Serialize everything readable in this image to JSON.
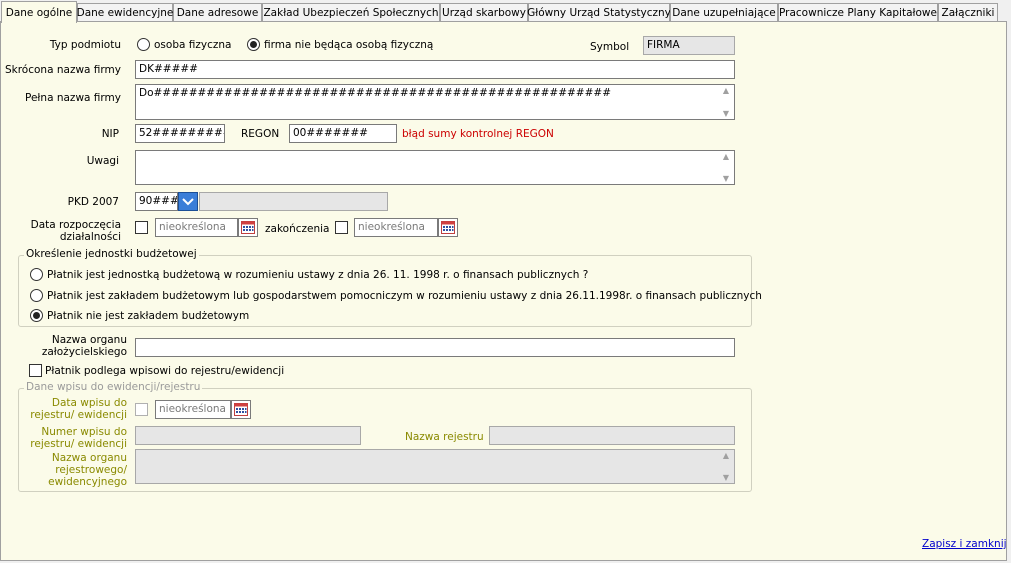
{
  "tabs": [
    {
      "label": "Dane ogólne",
      "active": true
    },
    {
      "label": "Dane ewidencyjne"
    },
    {
      "label": "Dane adresowe"
    },
    {
      "label": "Zakład Ubezpieczeń Społecznych"
    },
    {
      "label": "Urząd skarbowy"
    },
    {
      "label": "Główny Urząd Statystyczny"
    },
    {
      "label": "Dane uzupełniające"
    },
    {
      "label": "Pracownicze Plany Kapitałowe"
    },
    {
      "label": "Załączniki"
    }
  ],
  "form": {
    "typ_label": "Typ podmiotu",
    "typ_opt1": "osoba fizyczna",
    "typ_opt2": "firma nie będąca osobą fizyczną",
    "symbol_label": "Symbol",
    "symbol_value": "FIRMA",
    "skrocona_label": "Skrócona nazwa firmy",
    "skrocona_value": "DK#####",
    "pelna_label": "Pełna nazwa firmy",
    "pelna_value": "Do####################################################",
    "nip_label": "NIP",
    "nip_value": "52##########",
    "regon_label": "REGON",
    "regon_value": "00#######",
    "regon_error": "błąd sumy kontrolnej REGON",
    "uwagi_label": "Uwagi",
    "pkd_label": "PKD 2007",
    "pkd_value": "90###",
    "data_rozp_label_1": "Data rozpoczęcia",
    "data_rozp_label_2": "działalności",
    "date_placeholder": "nieokreślona",
    "zakonczenia_label": "zakończenia"
  },
  "budzet": {
    "title": "Określenie jednostki budżetowej",
    "opt1": "Płatnik jest jednostką budżetową w rozumieniu ustawy z dnia 26. 11. 1998 r. o finansach publicznych ?",
    "opt2": "Płatnik jest zakładem budżetowym lub gospodarstwem pomocniczym w rozumieniu ustawy z dnia 26.11.1998r. o finansach publicznych",
    "opt3": "Płatnik nie jest zakładem budżetowym"
  },
  "organ": {
    "label_1": "Nazwa organu",
    "label_2": "założycielskiego"
  },
  "rejestr": {
    "checkbox_label": "Płatnik podlega wpisowi do rejestru/ewidencji",
    "group_title": "Dane wpisu do ewidencji/rejestru",
    "data_label_1": "Data wpisu do",
    "data_label_2": "rejestru/ ewidencji",
    "numer_label_1": "Numer wpisu do",
    "numer_label_2": "rejestru/ ewidencji",
    "nazwa_rej_label": "Nazwa rejestru",
    "organ_label_1": "Nazwa organu",
    "organ_label_2": "rejestrowego/",
    "organ_label_3": "ewidencyjnego"
  },
  "footer": {
    "save_close": "Zapisz i zamknij"
  }
}
